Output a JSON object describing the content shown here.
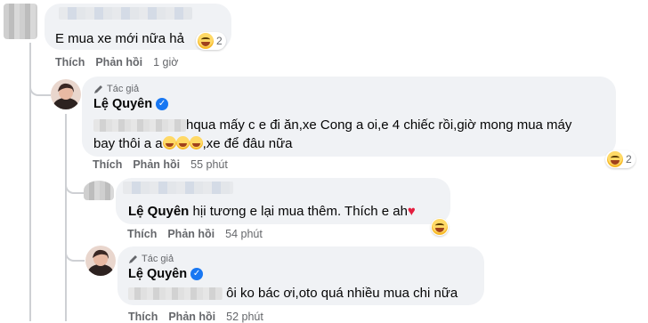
{
  "comment1": {
    "text": "E mua xe mới nữa hả",
    "reaction_count": "2",
    "actions": {
      "like": "Thích",
      "reply": "Phản hồi",
      "time": "1 giờ"
    }
  },
  "reply1": {
    "badge": "Tác giả",
    "author": "Lệ Quyên",
    "text_line1": "hqua mấy c e đi ăn,xe Cong a oi,e 4 chiếc rồi,giờ mong mua máy",
    "text_line2_start": "bay thôi a a",
    "text_line2_end": ",xe để đâu nữa",
    "reaction_count": "2",
    "actions": {
      "like": "Thích",
      "reply": "Phản hồi",
      "time": "55 phút"
    }
  },
  "reply2": {
    "tag": "Lệ Quyên",
    "text": " hịi tương e lại mua thêm. Thích e ah",
    "actions": {
      "like": "Thích",
      "reply": "Phản hồi",
      "time": "54 phút"
    }
  },
  "reply3": {
    "badge": "Tác giả",
    "author": "Lệ Quyên",
    "text": "ôi ko bác ơi,oto quá nhiều mua chi nữa",
    "actions": {
      "like": "Thích",
      "reply": "Phản hồi",
      "time": "52 phút"
    }
  },
  "icons": {
    "badge": "author-pen-icon",
    "verified": "verified-check-icon",
    "reaction": "laughing-emoji-icon",
    "heart": "red-heart-icon"
  },
  "colors": {
    "bubble": "#f0f2f5",
    "verified": "#1877f2",
    "muted": "#65676b"
  }
}
